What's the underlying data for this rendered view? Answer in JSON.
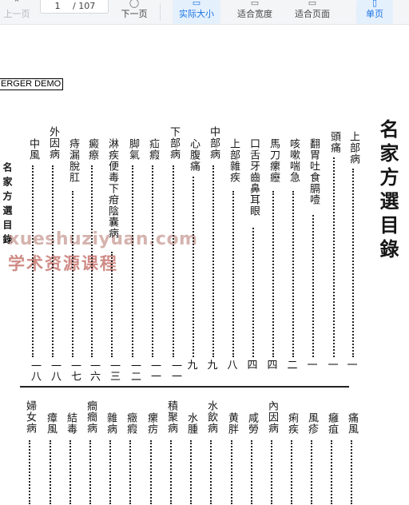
{
  "toolbar": {
    "prev_label": "上一页",
    "page_current": "1",
    "page_total": "/ 107",
    "next_label": "下一页",
    "actual_size_label": "实际大小",
    "fit_width_label": "适合宽度",
    "fit_page_label": "适合页面",
    "single_page_label": "单页"
  },
  "document": {
    "banner": "ERGER DEMO",
    "title": "名家方選目錄",
    "side_label": "名家方選目錄",
    "top_entries": [
      {
        "label": "上部病",
        "page": "一"
      },
      {
        "label": "頭痛",
        "page": "一"
      },
      {
        "label": "翻胃吐食膈噎",
        "page": "一"
      },
      {
        "label": "咳嗽喘急",
        "page": "二"
      },
      {
        "label": "馬刀瘰癧",
        "page": "四"
      },
      {
        "label": "口舌牙齒鼻耳眼",
        "page": "四"
      },
      {
        "label": "上部雜疾",
        "page": "八"
      },
      {
        "label": "中部病",
        "page": "九"
      },
      {
        "label": "心腹痛",
        "page": "九"
      },
      {
        "label": "下部病",
        "page": "一一"
      },
      {
        "label": "疝瘕",
        "page": "一一"
      },
      {
        "label": "脚氣",
        "page": "一二"
      },
      {
        "label": "淋疾便毒下疳陰囊病",
        "page": "一三"
      },
      {
        "label": "癜瘵",
        "page": "一六"
      },
      {
        "label": "痔漏脫肛",
        "page": "一七"
      },
      {
        "label": "外因病",
        "page": "一八"
      },
      {
        "label": "中風",
        "page": "一八"
      }
    ],
    "bottom_entries": [
      "痛風",
      "癰疽",
      "風疹",
      "痢疾",
      "內因病",
      "咸勞",
      "黄胖",
      "水飲病",
      "水腫",
      "積聚病",
      "瘰疠",
      "癥瘕",
      "雜病",
      "癎癇病",
      "結毒",
      "瘴風",
      "婦女病"
    ]
  },
  "watermark": {
    "line1": "xueshuziyuan.com",
    "line2": "学术资源课程"
  }
}
